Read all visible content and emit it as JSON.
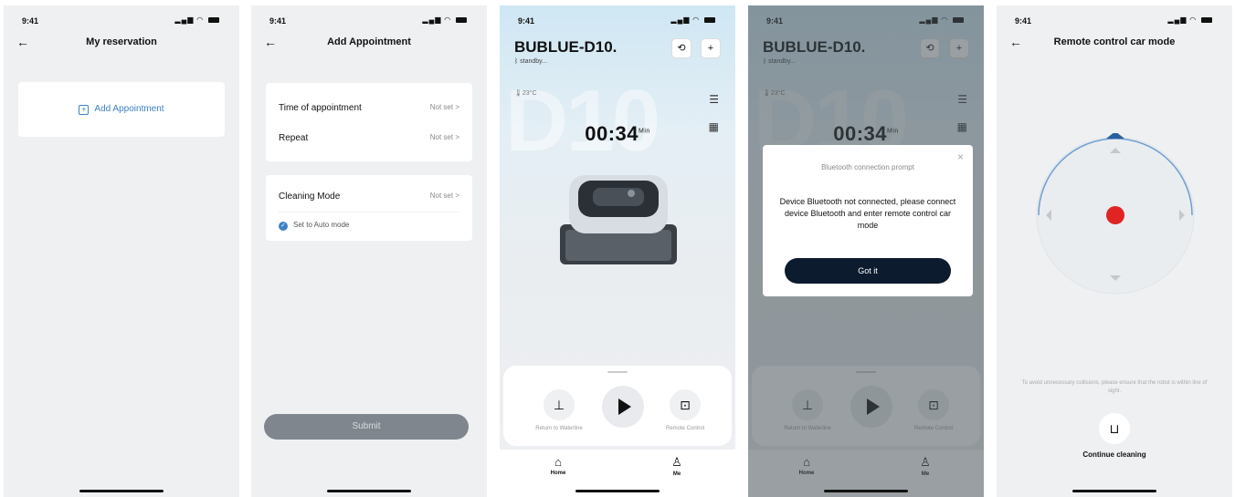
{
  "status": {
    "time": "9:41",
    "icons": "signal-wifi-battery"
  },
  "screen1": {
    "title": "My reservation",
    "add_label": "Add Appointment"
  },
  "screen2": {
    "title": "Add Appointment",
    "rows": [
      {
        "label": "Time of appointment",
        "value": "Not set >"
      },
      {
        "label": "Repeat",
        "value": "Not set >"
      }
    ],
    "cleaning": {
      "label": "Cleaning Mode",
      "value": "Not set >",
      "auto": "Set to Auto mode"
    },
    "submit": "Submit"
  },
  "device": {
    "name": "BUBLUE-D10.",
    "status": "standby...",
    "watermark": "D10",
    "temp": "23°C",
    "timer": "00:34",
    "timer_unit": "Min",
    "controls": {
      "return": "Return to Waterline",
      "remote": "Remote Control"
    },
    "tabs": {
      "home": "Home",
      "me": "Me"
    }
  },
  "modal": {
    "title": "Bluetooth connection prompt",
    "body": "Device Bluetooth not connected, please connect device Bluetooth and enter remote control car mode",
    "button": "Got it"
  },
  "screen5": {
    "title": "Remote control car mode",
    "note": "To avoid unnecessary collisions, please ensure that the robot is within line of sight.",
    "continue": "Continue cleaning"
  },
  "colors": {
    "accent": "#3b82c4",
    "dark_button": "#0c1b2e",
    "stop_dot": "#e02424"
  }
}
